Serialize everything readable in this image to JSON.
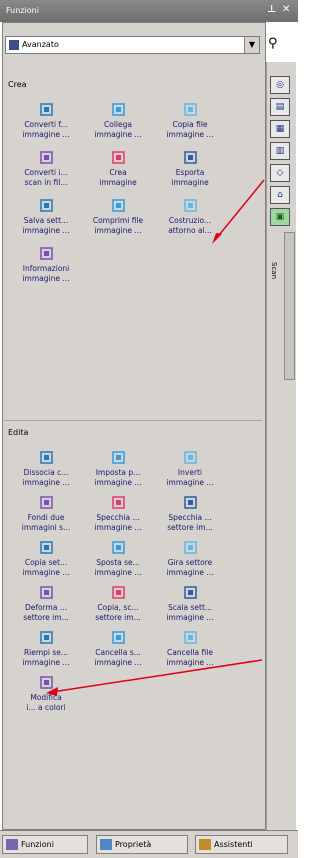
{
  "window": {
    "title": "Funzioni",
    "pin_icon": "pin-icon",
    "close_icon": "close-icon"
  },
  "mode_select": {
    "value": "Avanzato",
    "icon": "mode-icon"
  },
  "toolbar": {
    "find_icon": "binoculars-icon",
    "vertical_items": [
      "tool-1-icon",
      "tool-2-icon",
      "tool-3-icon",
      "tool-4-icon",
      "tool-5-icon",
      "tool-6-icon"
    ],
    "scan_label": "Scan"
  },
  "crea": {
    "heading": "Crea",
    "items": [
      {
        "l1": "Converti f...",
        "l2": "immagine ...",
        "icon": "convert-icon"
      },
      {
        "l1": "Collega",
        "l2": "immagine ...",
        "icon": "link-icon"
      },
      {
        "l1": "Copia file",
        "l2": "immagine ...",
        "icon": "copy-file-icon"
      },
      {
        "l1": "Converti i...",
        "l2": "scan in fil...",
        "icon": "convert-scan-icon"
      },
      {
        "l1": "Crea",
        "l2": "immagine",
        "icon": "create-image-icon"
      },
      {
        "l1": "Esporta",
        "l2": "immagine",
        "icon": "export-icon"
      },
      {
        "l1": "Salva sett...",
        "l2": "immagine ...",
        "icon": "save-icon"
      },
      {
        "l1": "Comprimi file",
        "l2": "immagine ...",
        "icon": "compress-icon"
      },
      {
        "l1": "Costruzio...",
        "l2": "attorno al...",
        "icon": "build-around-icon"
      },
      {
        "l1": "Informazioni",
        "l2": "immagine ...",
        "icon": "info-icon"
      }
    ]
  },
  "edita": {
    "heading": "Edita",
    "items": [
      {
        "l1": "Dissocia c...",
        "l2": "immagine ...",
        "icon": "dissociate-icon"
      },
      {
        "l1": "Imposta p...",
        "l2": "immagine ...",
        "icon": "set-icon"
      },
      {
        "l1": "Inverti",
        "l2": "immagine ...",
        "icon": "invert-icon"
      },
      {
        "l1": "Fondi due",
        "l2": "immagini s...",
        "icon": "merge-icon"
      },
      {
        "l1": "Specchia ...",
        "l2": "immagine ...",
        "icon": "mirror-icon"
      },
      {
        "l1": "Specchia ...",
        "l2": "settore im...",
        "icon": "mirror-sector-icon"
      },
      {
        "l1": "Copia set...",
        "l2": "immagine ...",
        "icon": "copy-sector-icon"
      },
      {
        "l1": "Sposta se...",
        "l2": "immagine ...",
        "icon": "move-sector-icon"
      },
      {
        "l1": "Gira settore",
        "l2": "immagine ...",
        "icon": "rotate-sector-icon"
      },
      {
        "l1": "Deforma ...",
        "l2": "settore im...",
        "icon": "deform-icon"
      },
      {
        "l1": "Copia, sc...",
        "l2": "settore im...",
        "icon": "copy-scale-icon"
      },
      {
        "l1": "Scala sett...",
        "l2": "immagine ...",
        "icon": "scale-sector-icon"
      },
      {
        "l1": "Riempi se...",
        "l2": "immagine ...",
        "icon": "fill-icon"
      },
      {
        "l1": "Cancella s...",
        "l2": "immagine ...",
        "icon": "delete-sector-icon"
      },
      {
        "l1": "Cancella file",
        "l2": "immagine ...",
        "icon": "delete-file-icon"
      },
      {
        "l1": "Modifica",
        "l2": "i... a colori",
        "icon": "modify-colors-icon"
      }
    ]
  },
  "tabs": [
    {
      "label": "Funzioni",
      "icon": "functions-tab-icon"
    },
    {
      "label": "Proprietà",
      "icon": "properties-tab-icon"
    },
    {
      "label": "Assistenti",
      "icon": "assistants-tab-icon"
    }
  ],
  "colors": {
    "arrow": "#e0001a",
    "accent": "#1a7dc2"
  }
}
